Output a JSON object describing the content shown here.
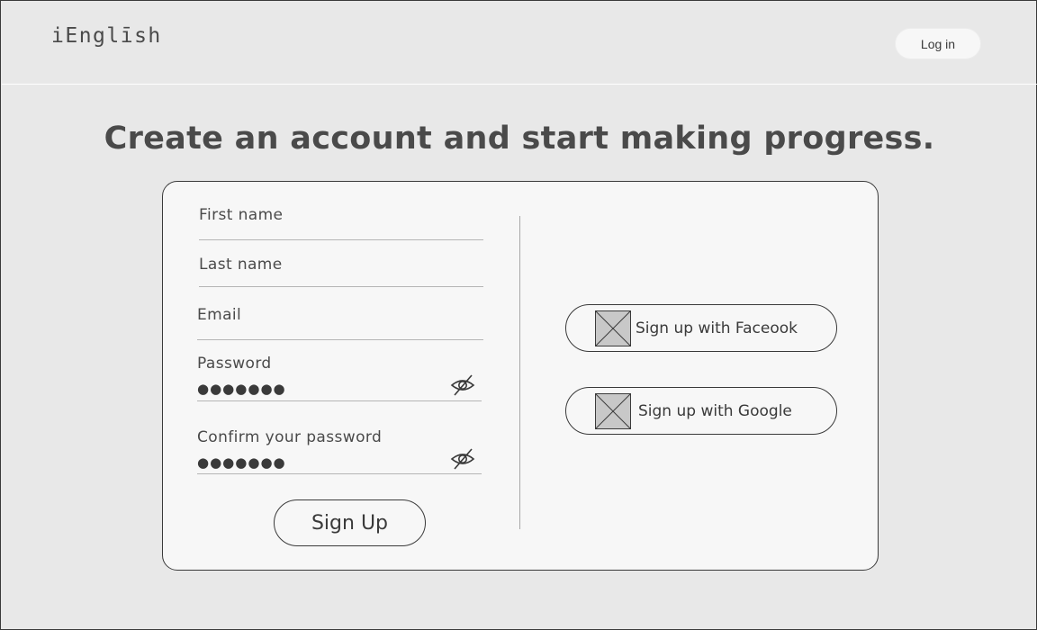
{
  "header": {
    "logo": "iEnglīsh",
    "login_label": "Log in"
  },
  "main": {
    "title": "Create an account and start making progress."
  },
  "form": {
    "first_name_label": "First name",
    "last_name_label": "Last name",
    "email_label": "Email",
    "password_label": "Password",
    "password_value": "●●●●●●●",
    "confirm_label": "Confirm your password",
    "confirm_value": "●●●●●●●",
    "signup_label": "Sign Up"
  },
  "social": {
    "facebook_label": "Sign up with Faceook",
    "google_label": "Sign up with Google"
  },
  "icons": {
    "password_toggle": "eye-slash-icon",
    "social_placeholder": "image-placeholder-icon"
  },
  "colors": {
    "background": "#e8e8e8",
    "card": "#f7f7f7",
    "border": "#3a3a3a",
    "text": "#4a4a4a"
  }
}
